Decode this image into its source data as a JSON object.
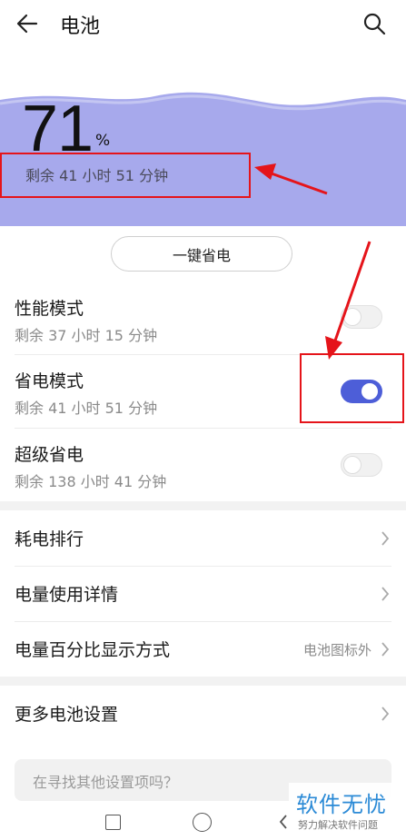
{
  "header": {
    "title": "电池",
    "back_icon": "back-arrow-icon",
    "search_icon": "search-icon"
  },
  "battery": {
    "percent": "71",
    "unit": "%",
    "remaining": "剩余 41 小时 51 分钟",
    "hero_color": "#a7a9ec"
  },
  "one_key_button": "一键省电",
  "modes": [
    {
      "title": "性能模式",
      "subtitle": "剩余 37 小时 15 分钟",
      "enabled": false
    },
    {
      "title": "省电模式",
      "subtitle": "剩余 41 小时 51 分钟",
      "enabled": true
    },
    {
      "title": "超级省电",
      "subtitle": "剩余 138 小时 41 分钟",
      "enabled": false
    }
  ],
  "list": [
    {
      "label": "耗电排行",
      "value": ""
    },
    {
      "label": "电量使用详情",
      "value": ""
    },
    {
      "label": "电量百分比显示方式",
      "value": "电池图标外"
    }
  ],
  "more": {
    "label": "更多电池设置"
  },
  "search_suggestion": {
    "text": "在寻找其他设置项吗？"
  },
  "watermark": {
    "title": "软件无忧",
    "subtitle": "努力解决软件问题"
  },
  "colors": {
    "accent": "#4d5ed8",
    "annotation": "#e5141a"
  }
}
